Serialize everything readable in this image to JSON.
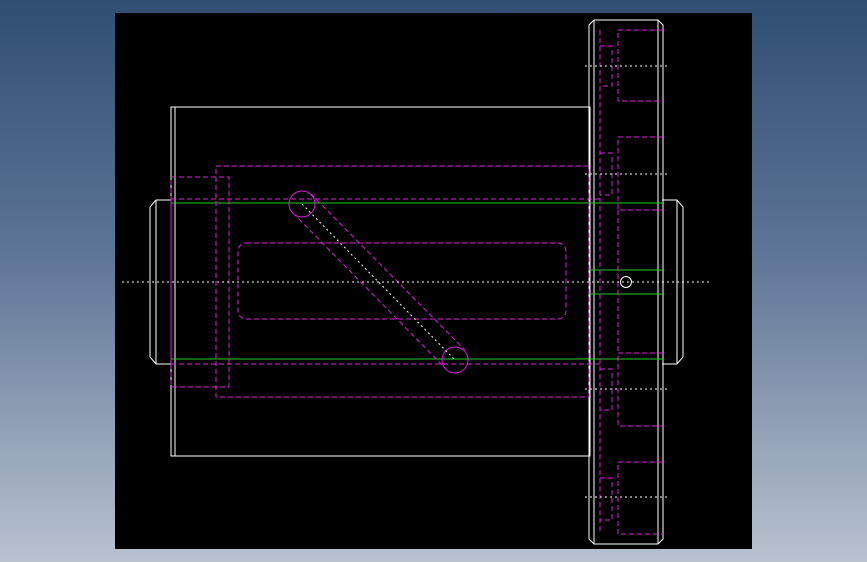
{
  "viewport": {
    "background_gradient": [
      "#2f4e73",
      "#5d7596",
      "#b9c2cf"
    ],
    "canvas_color": "#000000"
  },
  "drawing": {
    "visible_line_color": "#ffffff",
    "hidden_line_color": "#e020e0",
    "center_line_color": "#ffffff",
    "tangent_edge_color": "#22cc22"
  }
}
